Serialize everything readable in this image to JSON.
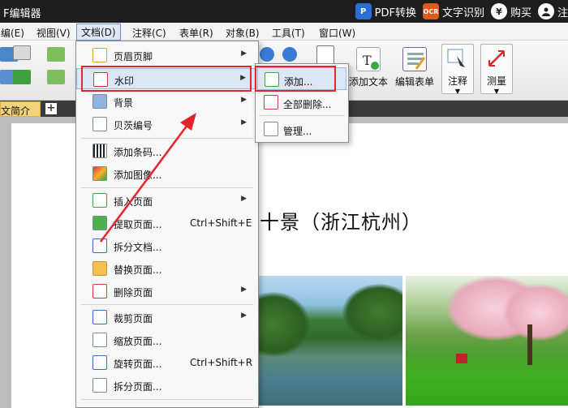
{
  "titlebar": {
    "title": "F编辑器",
    "pdf_convert": "PDF转换",
    "ocr_badge": "OCR",
    "ocr": "文字识别",
    "buy_symbol": "¥",
    "buy": "购买",
    "register": "注"
  },
  "menubar": {
    "items": [
      "编(E)",
      "视图(V)",
      "文档(D)",
      "注释(C)",
      "表单(R)",
      "对象(B)",
      "工具(T)",
      "窗口(W)"
    ]
  },
  "toolbar": {
    "add_text": "添加文本",
    "edit_form": "编辑表单",
    "annotate": "注释",
    "measure": "测量"
  },
  "tabs": {
    "doc_tab": "文简介",
    "new_tab": "+"
  },
  "document": {
    "heading": "十景（浙江杭州）"
  },
  "dropdown": {
    "items": [
      {
        "label": "页眉页脚",
        "shortcut": "",
        "arrow": "▶"
      },
      {
        "label": "水印",
        "shortcut": "",
        "arrow": "▶"
      },
      {
        "label": "背景",
        "shortcut": "",
        "arrow": "▶"
      },
      {
        "label": "贝茨编号",
        "shortcut": "",
        "arrow": "▶"
      },
      {
        "label": "添加条码...",
        "shortcut": "",
        "arrow": ""
      },
      {
        "label": "添加图像...",
        "shortcut": "",
        "arrow": ""
      },
      {
        "label": "插入页面",
        "shortcut": "",
        "arrow": "▶"
      },
      {
        "label": "提取页面...",
        "shortcut": "Ctrl+Shift+E",
        "arrow": ""
      },
      {
        "label": "拆分文档...",
        "shortcut": "",
        "arrow": ""
      },
      {
        "label": "替换页面...",
        "shortcut": "",
        "arrow": ""
      },
      {
        "label": "删除页面",
        "shortcut": "",
        "arrow": "▶"
      },
      {
        "label": "裁剪页面",
        "shortcut": "",
        "arrow": "▶"
      },
      {
        "label": "缩放页面...",
        "shortcut": "",
        "arrow": ""
      },
      {
        "label": "旋转页面...",
        "shortcut": "Ctrl+Shift+R",
        "arrow": ""
      },
      {
        "label": "拆分页面...",
        "shortcut": "",
        "arrow": ""
      }
    ]
  },
  "submenu": {
    "items": [
      {
        "label": "添加..."
      },
      {
        "label": "全部删除..."
      },
      {
        "label": "管理..."
      }
    ]
  },
  "colors": {
    "accent": "#e4242a",
    "highlight": "#dbe6f6",
    "tab": "#f2d27a"
  }
}
